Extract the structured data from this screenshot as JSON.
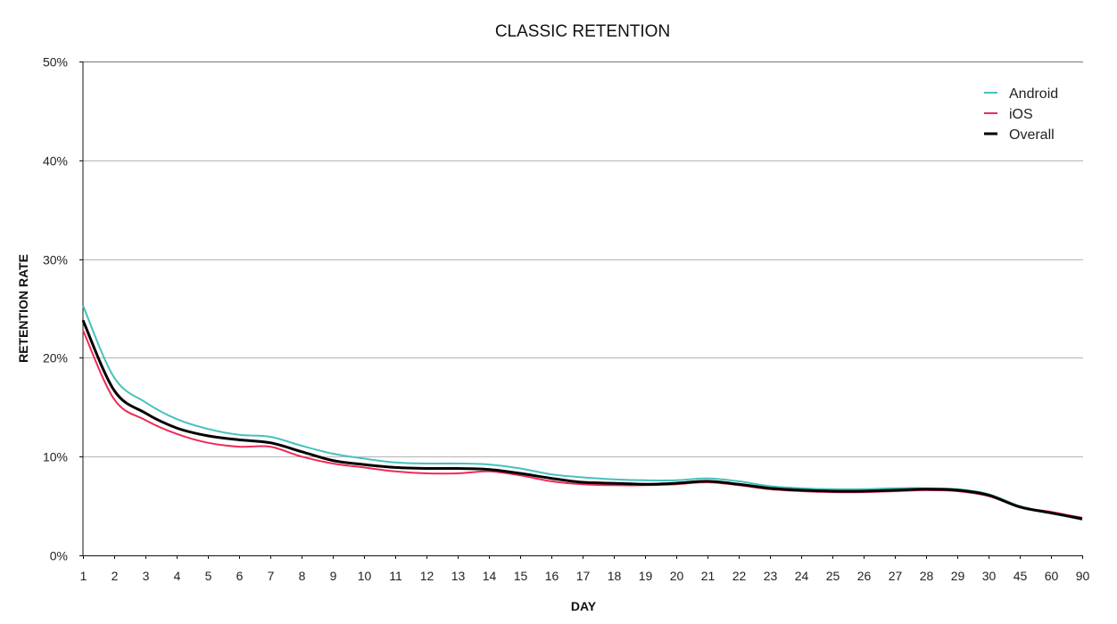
{
  "chart_data": {
    "type": "line",
    "title": "CLASSIC RETENTION",
    "xlabel": "DAY",
    "ylabel": "RETENTION RATE",
    "ylim": [
      0,
      50
    ],
    "yticks": [
      "0%",
      "10%",
      "20%",
      "30%",
      "40%",
      "50%"
    ],
    "ytick_values": [
      0,
      10,
      20,
      30,
      40,
      50
    ],
    "grid": true,
    "legend_position": "top-right",
    "categories": [
      "1",
      "2",
      "3",
      "4",
      "5",
      "6",
      "7",
      "8",
      "9",
      "10",
      "11",
      "12",
      "13",
      "14",
      "15",
      "16",
      "17",
      "18",
      "19",
      "20",
      "21",
      "22",
      "23",
      "24",
      "25",
      "26",
      "27",
      "28",
      "29",
      "30",
      "45",
      "60",
      "90"
    ],
    "series": [
      {
        "name": "Android",
        "color": "#45c1bd",
        "values": [
          25.3,
          18.0,
          15.5,
          13.8,
          12.8,
          12.2,
          12.0,
          11.1,
          10.3,
          9.8,
          9.4,
          9.3,
          9.3,
          9.2,
          8.8,
          8.2,
          7.9,
          7.7,
          7.6,
          7.6,
          7.8,
          7.5,
          7.0,
          6.8,
          6.7,
          6.7,
          6.8,
          6.8,
          6.7,
          6.2,
          5.0,
          4.3,
          3.6
        ]
      },
      {
        "name": "iOS",
        "color": "#f02a57",
        "values": [
          22.8,
          15.8,
          13.7,
          12.3,
          11.4,
          11.0,
          11.0,
          10.0,
          9.3,
          8.9,
          8.5,
          8.3,
          8.3,
          8.5,
          8.1,
          7.5,
          7.2,
          7.1,
          7.1,
          7.2,
          7.4,
          7.1,
          6.7,
          6.5,
          6.4,
          6.4,
          6.5,
          6.6,
          6.5,
          6.0,
          4.9,
          4.4,
          3.8
        ]
      },
      {
        "name": "Overall",
        "color": "#000000",
        "values": [
          23.8,
          16.7,
          14.4,
          12.9,
          12.1,
          11.7,
          11.4,
          10.5,
          9.6,
          9.2,
          8.9,
          8.8,
          8.8,
          8.7,
          8.3,
          7.8,
          7.4,
          7.3,
          7.2,
          7.3,
          7.5,
          7.2,
          6.8,
          6.6,
          6.5,
          6.5,
          6.6,
          6.7,
          6.6,
          6.1,
          4.9,
          4.3,
          3.7
        ]
      }
    ]
  }
}
